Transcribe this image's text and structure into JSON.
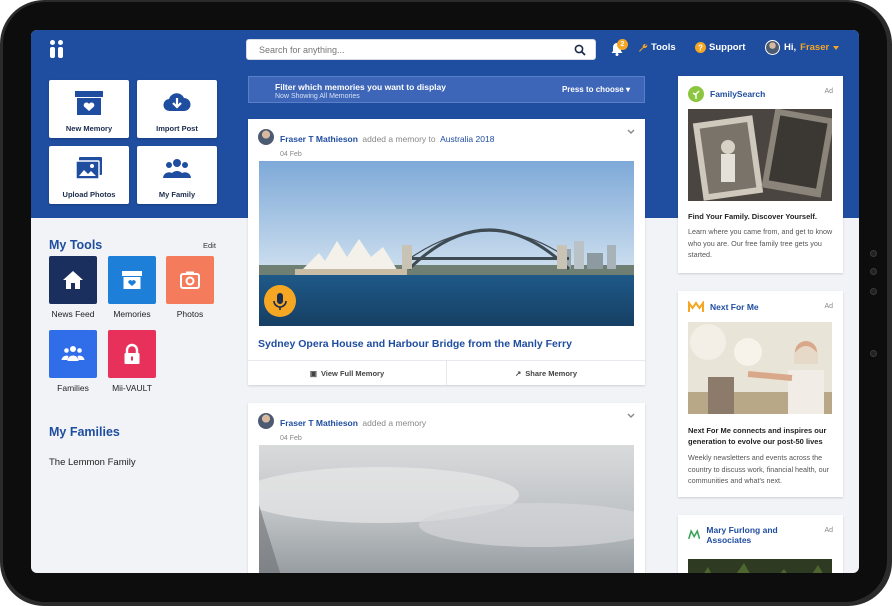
{
  "header": {
    "search_placeholder": "Search for anything...",
    "notification_count": "2",
    "tools_label": "Tools",
    "support_label": "Support",
    "greeting": "Hi,",
    "user_name": "Fraser"
  },
  "quick_tiles": [
    {
      "label": "New Memory",
      "icon": "memory-box-icon"
    },
    {
      "label": "Import Post",
      "icon": "cloud-download-icon"
    },
    {
      "label": "Upload Photos",
      "icon": "photos-icon"
    },
    {
      "label": "My Family",
      "icon": "people-icon"
    }
  ],
  "my_tools": {
    "title": "My Tools",
    "edit_label": "Edit",
    "items": [
      {
        "label": "News Feed",
        "icon": "home-icon",
        "color": "#1b2f5e"
      },
      {
        "label": "Memories",
        "icon": "memory-box-icon",
        "color": "#1e7fd8"
      },
      {
        "label": "Photos",
        "icon": "camera-icon",
        "color": "#f47c5c"
      },
      {
        "label": "Families",
        "icon": "people-icon",
        "color": "#2f6ee8"
      },
      {
        "label": "Mii-VAULT",
        "icon": "lock-icon",
        "color": "#e8315a"
      }
    ]
  },
  "my_families": {
    "title": "My Families",
    "items": [
      "The Lemmon Family"
    ]
  },
  "filter": {
    "title": "Filter which memories you want to display",
    "subtitle": "Now Showing All Memories",
    "choose_label": "Press to choose"
  },
  "posts": [
    {
      "author": "Fraser T Mathieson",
      "action": "added a memory to",
      "target": "Australia 2018",
      "date": "04 Feb",
      "title": "Sydney Opera House and Harbour Bridge from the Manly Ferry",
      "view_label": "View Full Memory",
      "share_label": "Share Memory"
    },
    {
      "author": "Fraser T Mathieson",
      "action": "added a memory",
      "target": "",
      "date": "04 Feb"
    }
  ],
  "ads": [
    {
      "brand": "FamilySearch",
      "ad_label": "Ad",
      "title": "Find Your Family. Discover Yourself.",
      "description": "Learn where you came from, and get to know who you are. Our free family tree gets you started."
    },
    {
      "brand": "Next For Me",
      "ad_label": "Ad",
      "title": "Next For Me connects and inspires our generation to evolve our post-50 lives",
      "description": "Weekly newsletters and events across the country to discuss work, financial health, our communities and what's next."
    },
    {
      "brand": "Mary Furlong and Associates",
      "ad_label": "Ad"
    }
  ]
}
